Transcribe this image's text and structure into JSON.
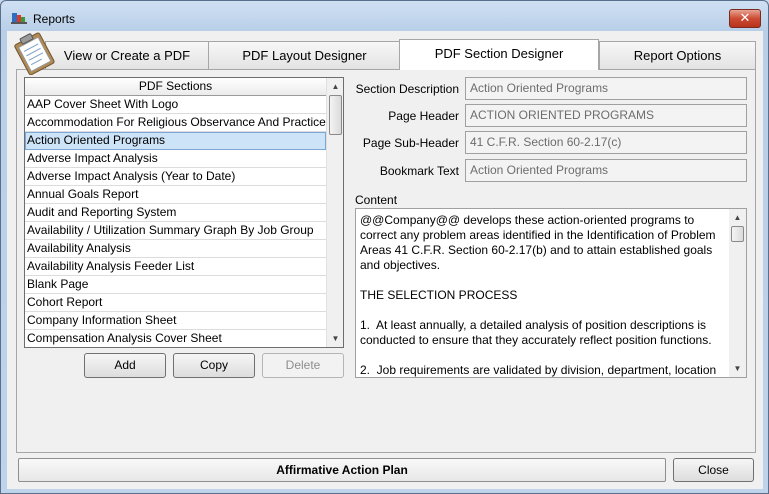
{
  "window": {
    "title": "Reports",
    "close_glyph": "✕"
  },
  "tabs": [
    {
      "label": "View or Create a PDF"
    },
    {
      "label": "PDF Layout Designer"
    },
    {
      "label": "PDF Section Designer"
    },
    {
      "label": "Report Options"
    }
  ],
  "sections_list": {
    "header": "PDF Sections",
    "items": [
      "AAP Cover Sheet With Logo",
      "Accommodation For Religious Observance And Practices",
      "Action Oriented Programs",
      "Adverse Impact Analysis",
      "Adverse Impact Analysis (Year to Date)",
      "Annual Goals Report",
      "Audit and Reporting System",
      "Availability / Utilization Summary Graph By Job Group",
      "Availability Analysis",
      "Availability Analysis Feeder List",
      "Blank Page",
      "Cohort Report",
      "Company Information Sheet",
      "Compensation Analysis Cover Sheet"
    ],
    "selected": "Action Oriented Programs"
  },
  "buttons": {
    "add": "Add",
    "copy": "Copy",
    "delete": "Delete",
    "close": "Close"
  },
  "fields": {
    "section_description": {
      "label": "Section Description",
      "value": "Action Oriented Programs"
    },
    "page_header": {
      "label": "Page Header",
      "value": "ACTION ORIENTED PROGRAMS"
    },
    "page_subheader": {
      "label": "Page Sub-Header",
      "value": "41 C.F.R. Section 60-2.17(c)"
    },
    "bookmark_text": {
      "label": "Bookmark Text",
      "value": "Action Oriented Programs"
    }
  },
  "content": {
    "label": "Content",
    "text": "@@Company@@ develops these action-oriented programs to correct any problem areas identified in the Identification of Problem Areas 41 C.F.R. Section 60-2.17(b) and to attain established goals and objectives.\n\nTHE SELECTION PROCESS\n\n1.  At least annually, a detailed analysis of position descriptions is conducted to ensure that they accurately reflect position functions.\n\n2.  Job requirements are validated by division, department, location"
  },
  "status_bar": {
    "text": "Affirmative Action Plan"
  },
  "icons": {
    "app": "reports-icon",
    "clipboard": "clipboard-icon"
  }
}
